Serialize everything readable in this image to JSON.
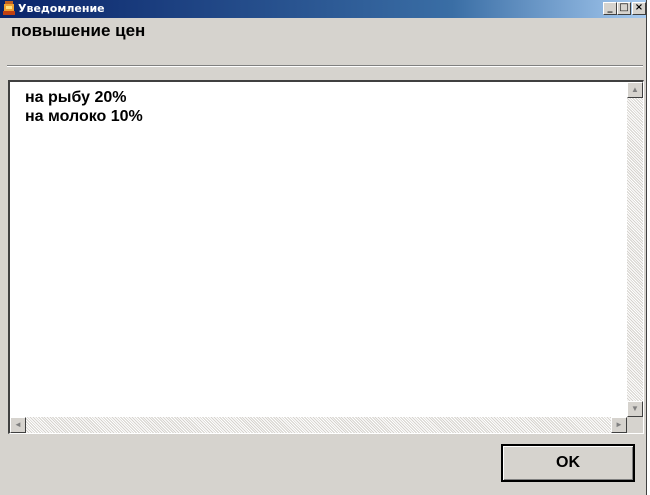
{
  "window": {
    "title": "Уведомление",
    "controls": {
      "minimize": "_",
      "maximize": "□",
      "close": "×"
    }
  },
  "heading": "повышение цен",
  "message": {
    "lines": [
      "на рыбу 20%",
      "на молоко 10%"
    ]
  },
  "scrollbars": {
    "up_icon": "arrow-up-icon",
    "down_icon": "arrow-down-icon",
    "left_icon": "arrow-left-icon",
    "right_icon": "arrow-right-icon",
    "up": "▲",
    "down": "▼",
    "left": "◄",
    "right": "►"
  },
  "buttons": {
    "ok": "OK"
  },
  "colors": {
    "titlebar_start": "#0a246a",
    "titlebar_end": "#a6caf0",
    "window_bg": "#d6d3ce"
  }
}
